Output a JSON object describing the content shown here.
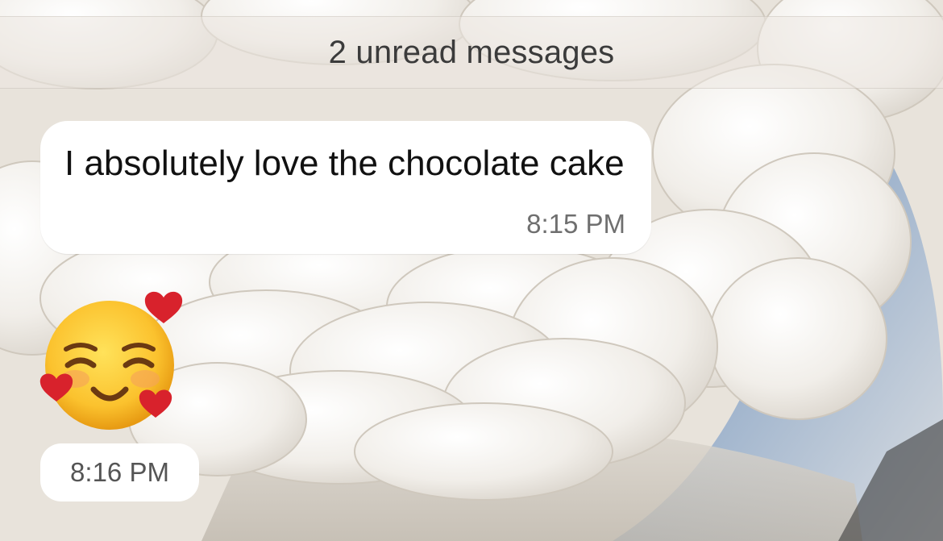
{
  "wallpaper": {
    "icon": "cake-petals-background"
  },
  "banner": {
    "label": "2 unread messages"
  },
  "messages": [
    {
      "text": "I absolutely love the chocolate cake",
      "time": "8:15 PM"
    },
    {
      "emoji": "smiling-face-with-hearts-icon",
      "time": "8:16 PM"
    }
  ],
  "colors": {
    "bubble": "#ffffff",
    "text": "#111111",
    "timestamp": "#6f6f6f",
    "banner_text": "#3b3b3b"
  }
}
